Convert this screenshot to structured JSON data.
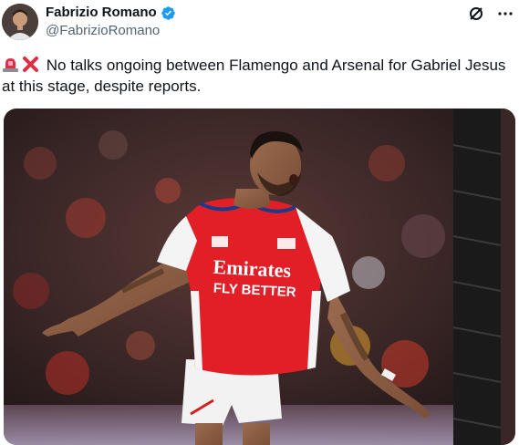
{
  "author": {
    "display_name": "Fabrizio Romano",
    "handle": "@FabrizioRomano",
    "verified": true,
    "verified_color": "#1d9bf0"
  },
  "actions": {
    "icon_left": "grok-slash-icon",
    "icon_right": "more-options-icon"
  },
  "tweet": {
    "emojis": [
      "police-light-emoji",
      "cross-mark-emoji"
    ],
    "text": "No talks ongoing between Flamengo and Arsenal for Gabriel Jesus at this stage, despite reports."
  },
  "media": {
    "subject": "footballer-celebrating-photo",
    "shirt_sponsor": "Emirates",
    "shirt_slogan": "FLY BETTER",
    "colors": {
      "shirt_red": "#e21f26",
      "background_dark": "#2a1f1f"
    }
  }
}
